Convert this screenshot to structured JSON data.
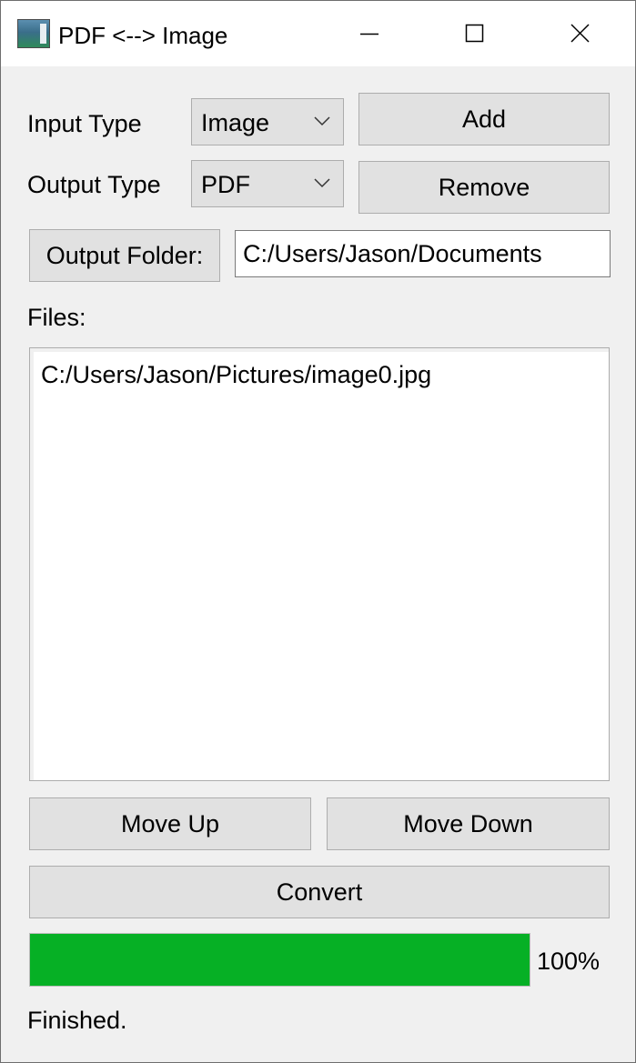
{
  "window": {
    "title": "PDF <--> Image",
    "controls": {
      "minimize": "minimize-icon",
      "maximize": "maximize-icon",
      "close": "close-icon"
    }
  },
  "form": {
    "input_type_label": "Input Type",
    "input_type_value": "Image",
    "output_type_label": "Output Type",
    "output_type_value": "PDF",
    "add_button": "Add",
    "remove_button": "Remove",
    "output_folder_button": "Output Folder:",
    "output_folder_value": "C:/Users/Jason/Documents",
    "files_label": "Files:",
    "files": [
      "C:/Users/Jason/Pictures/image0.jpg"
    ]
  },
  "actions": {
    "move_up": "Move Up",
    "move_down": "Move Down",
    "convert": "Convert"
  },
  "progress": {
    "value": 100,
    "text": "100%",
    "color": "#06b025"
  },
  "status": "Finished."
}
